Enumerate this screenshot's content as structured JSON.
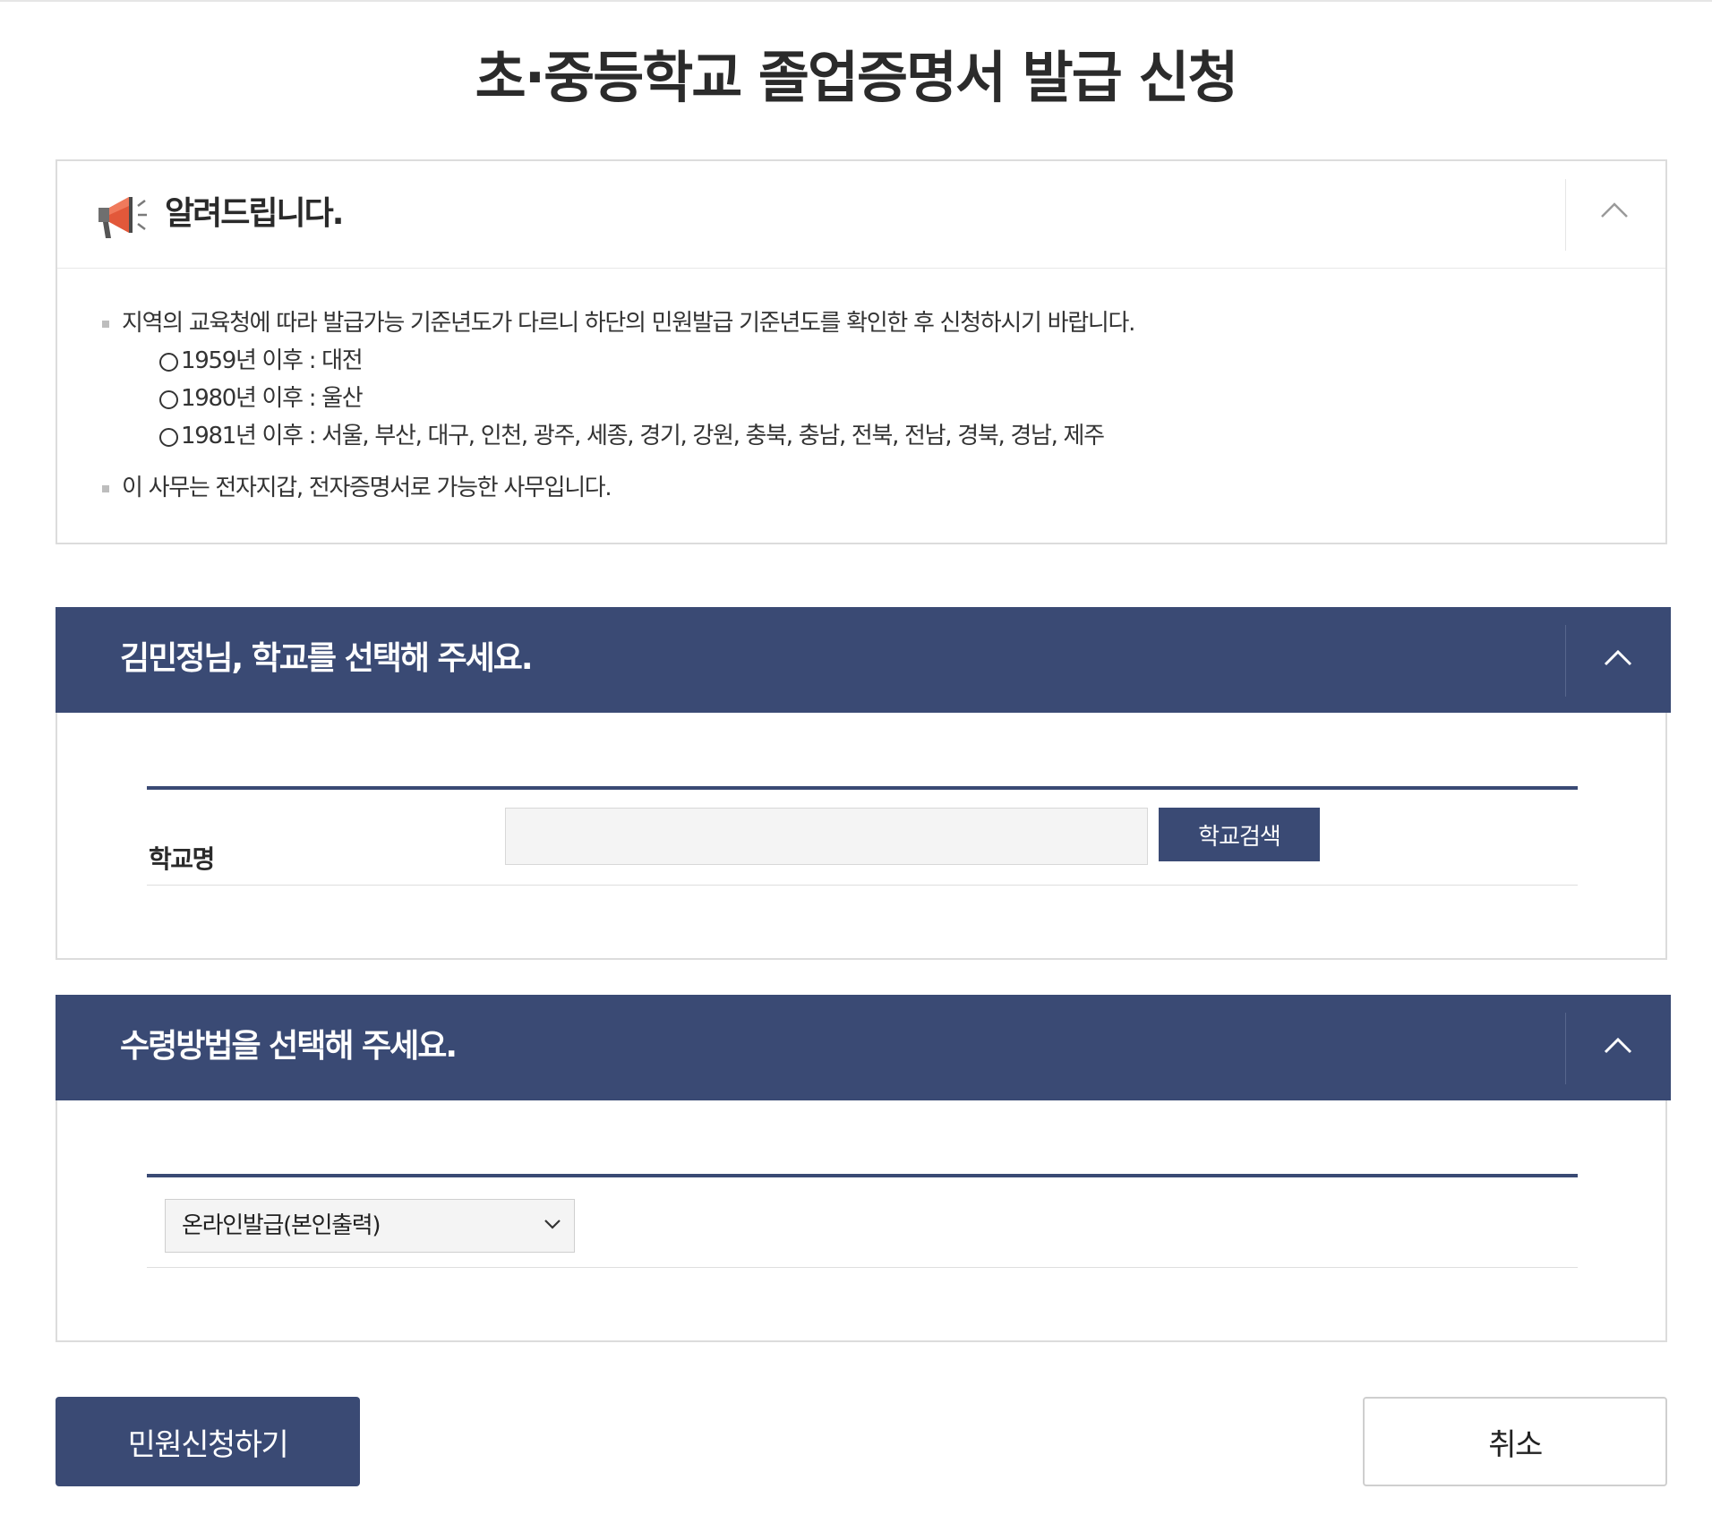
{
  "page": {
    "title": "초·중등학교 졸업증명서 발급 신청"
  },
  "notice": {
    "icon": "megaphone-icon",
    "title": "알려드립니다.",
    "toggle_icon": "chevron-up-icon",
    "items": [
      "지역의 교육청에 따라 발급가능 기준년도가 다르니 하단의 민원발급 기준년도를 확인한 후 신청하시기 바랍니다.",
      "이 사무는 전자지갑, 전자증명서로 가능한 사무입니다."
    ],
    "sub_items": [
      "1959년 이후 : 대전",
      "1980년 이후 : 울산",
      "1981년 이후 : 서울, 부산, 대구, 인천, 광주, 세종, 경기, 강원, 충북, 충남, 전북, 전남, 경북, 경남, 제주"
    ]
  },
  "school_section": {
    "title": "김민정님, 학교를 선택해 주세요.",
    "field_label": "학교명",
    "input_value": "",
    "search_button": "학교검색"
  },
  "receipt_section": {
    "title": "수령방법을 선택해 주세요.",
    "selected_option": "온라인발급(본인출력)"
  },
  "actions": {
    "submit": "민원신청하기",
    "cancel": "취소"
  },
  "colors": {
    "primary": "#3a4a74",
    "border": "#dcdcdc",
    "input_bg": "#f4f4f4",
    "megaphone": "#e2583a"
  }
}
